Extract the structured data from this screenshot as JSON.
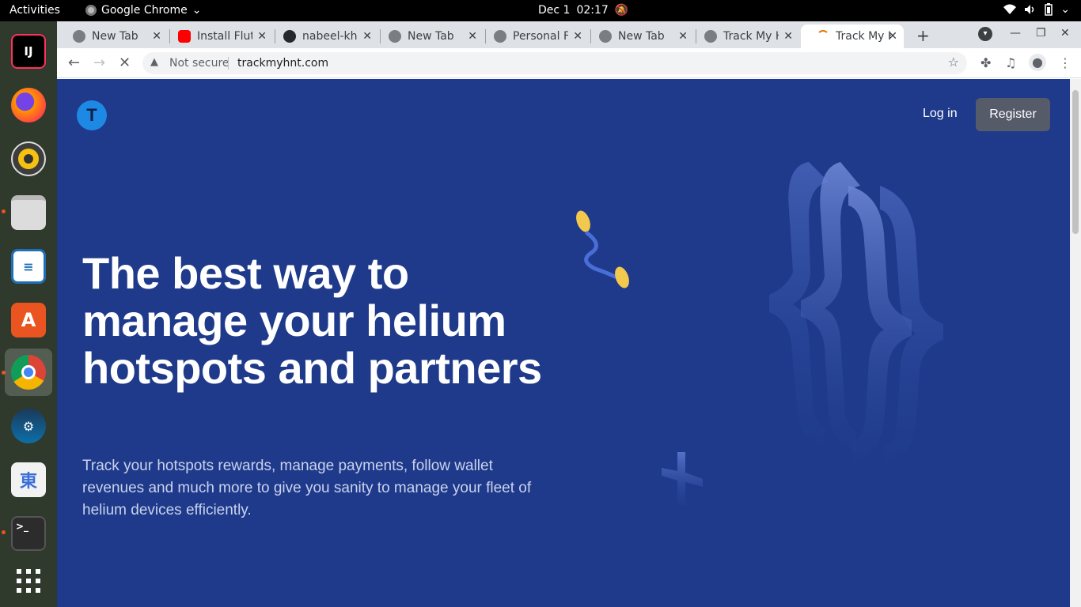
{
  "system": {
    "activities": "Activities",
    "app_name": "Google Chrome",
    "date": "Dec 1",
    "time": "02:17"
  },
  "tabs": [
    {
      "title": "New Tab",
      "icon": "chrome-icon"
    },
    {
      "title": "Install Flutter",
      "icon": "youtube-icon"
    },
    {
      "title": "nabeel-kh",
      "icon": "github-icon"
    },
    {
      "title": "New Tab",
      "icon": "chrome-icon"
    },
    {
      "title": "Personal F",
      "icon": "globe-icon"
    },
    {
      "title": "New Tab",
      "icon": "chrome-icon"
    },
    {
      "title": "Track My H",
      "icon": "globe-icon"
    },
    {
      "title": "Track My H",
      "icon": "loading-icon",
      "active": true
    }
  ],
  "toolbar": {
    "security_label": "Not secure",
    "url": "trackmyhnt.com"
  },
  "page": {
    "logo_letter": "T",
    "login_label": "Log in",
    "register_label": "Register",
    "headline_1": "The best way to",
    "headline_2": "manage your helium",
    "headline_3": "hotspots and partners",
    "subtext": "Track your hotspots rewards, manage payments, follow wallet revenues and much more to give you sanity to manage your fleet of helium devices efficiently."
  },
  "colors": {
    "page_background": "#1f3a8a",
    "register_button": "#565b6a",
    "logo_circle": "#1e88e5",
    "coin_yellow": "#f2c94c"
  }
}
